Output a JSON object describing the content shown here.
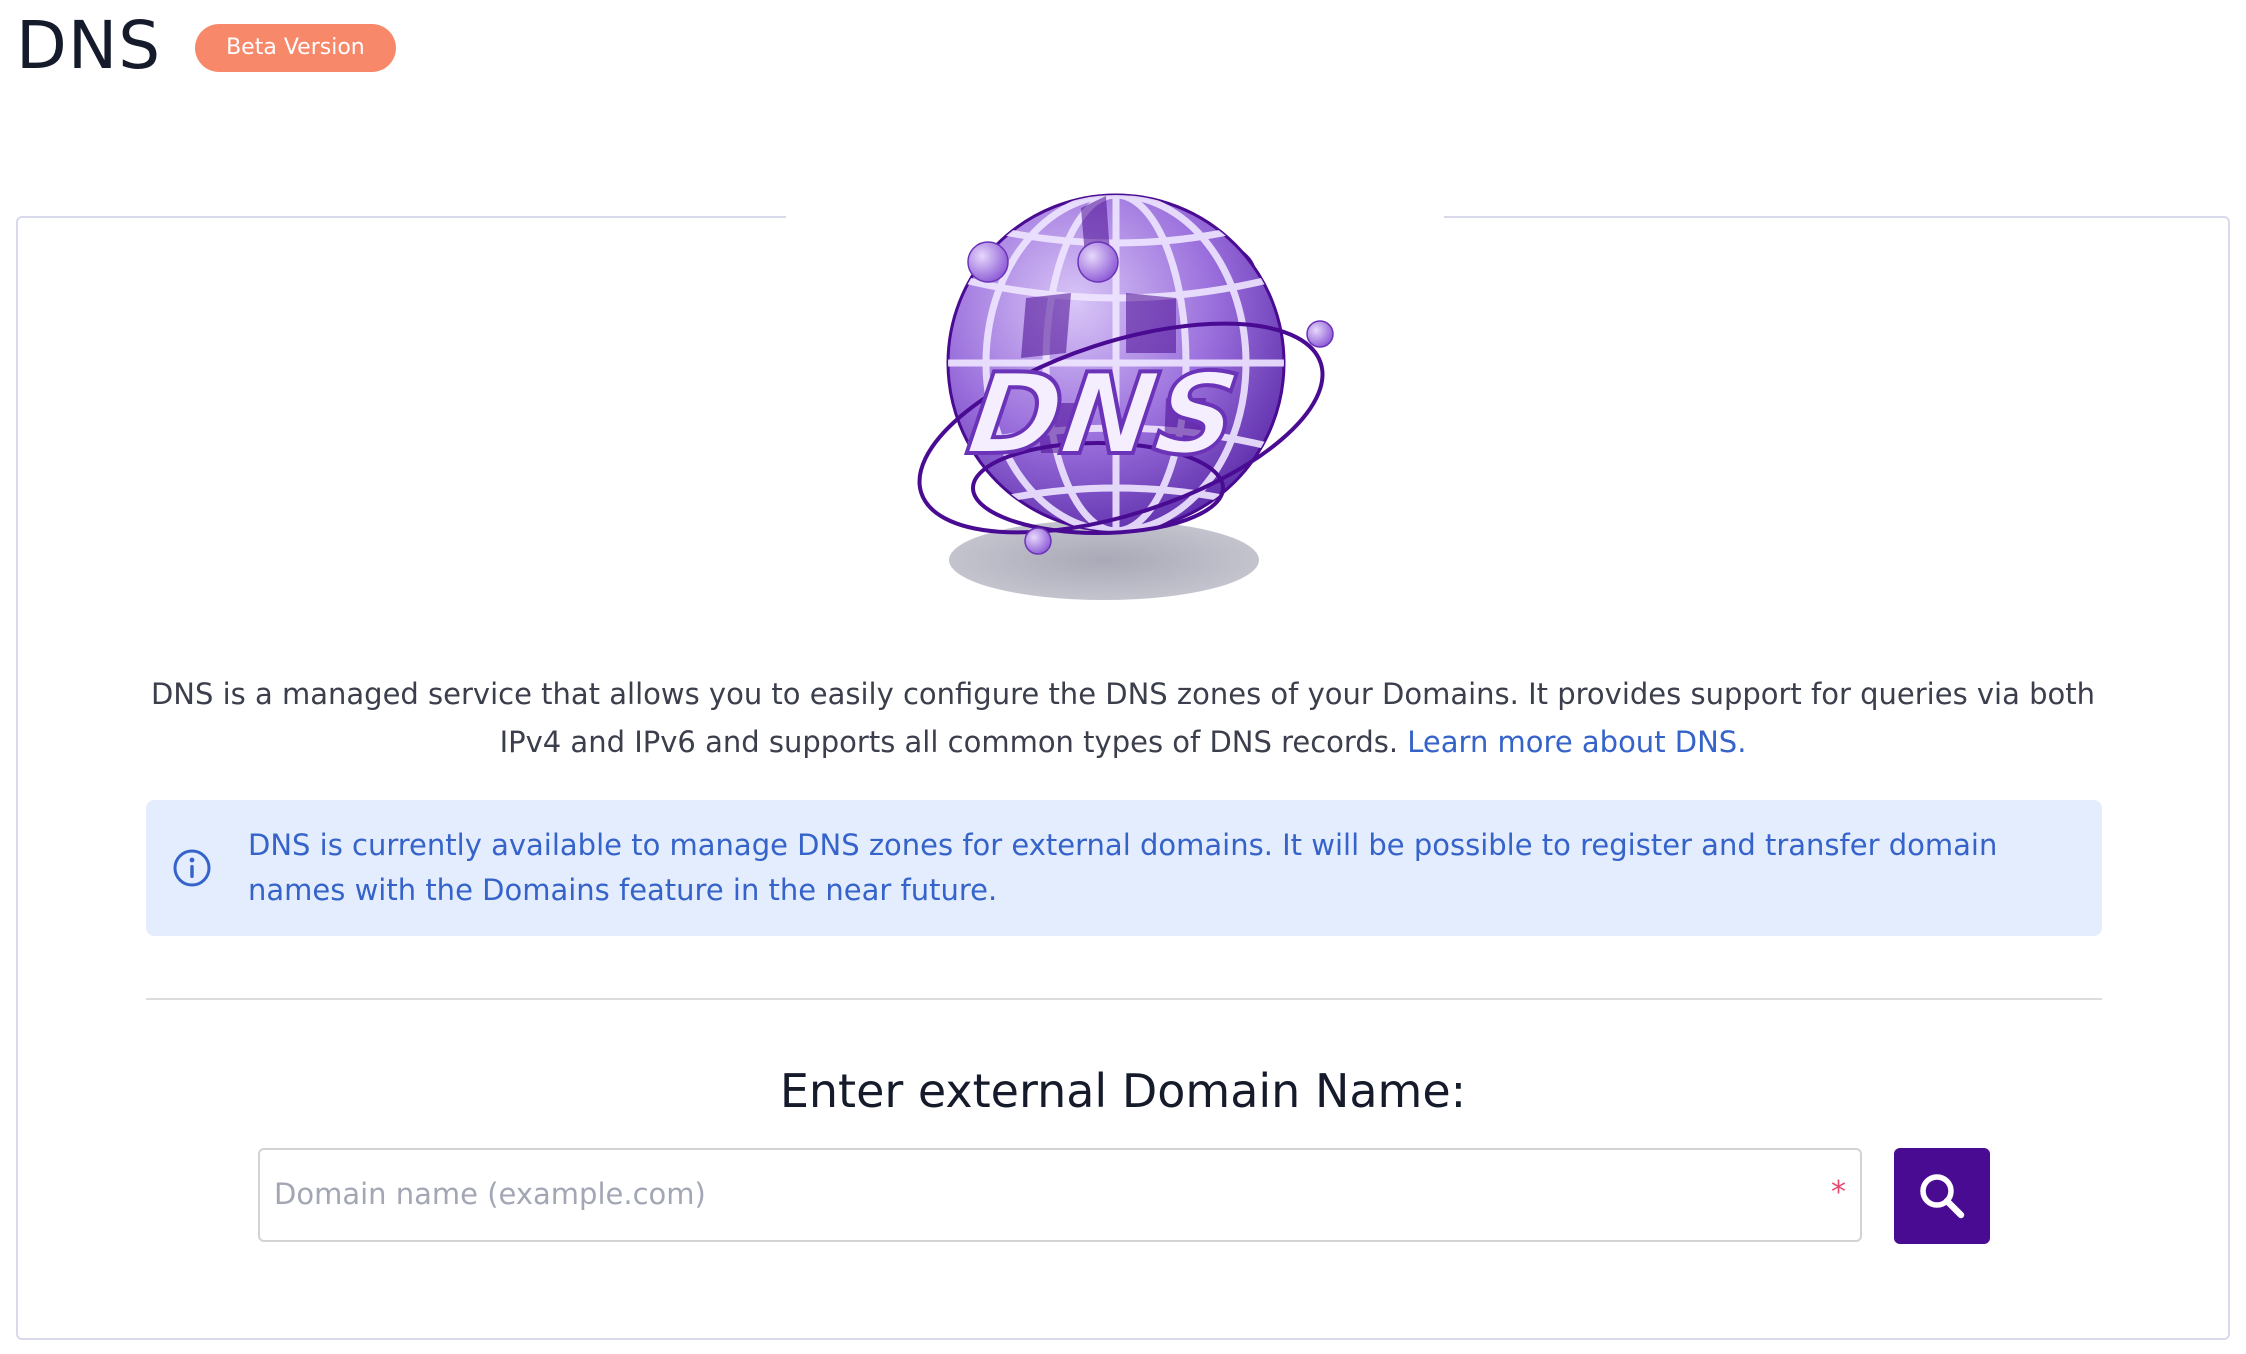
{
  "header": {
    "title": "DNS",
    "badge": "Beta Version"
  },
  "hero": {
    "logo_text": "DNS",
    "icon": "dns-globe-icon"
  },
  "description": {
    "text": "DNS is a managed service that allows you to easily configure the DNS zones of your Domains. It provides support for queries via both IPv4 and IPv6 and supports all common types of DNS records.",
    "link_label": "Learn more about DNS."
  },
  "info": {
    "icon": "info-icon",
    "text": "DNS is currently available to manage DNS zones for external domains. It will be possible to register and transfer domain names with the Domains feature in the near future."
  },
  "search": {
    "prompt": "Enter external Domain Name:",
    "placeholder": "Domain name (example.com)",
    "value": "",
    "required_mark": "*",
    "button_icon": "search-icon"
  },
  "colors": {
    "accent": "#4a0b93",
    "badge": "#f7886a",
    "link": "#3563c9",
    "info_background": "#e3edfd"
  }
}
